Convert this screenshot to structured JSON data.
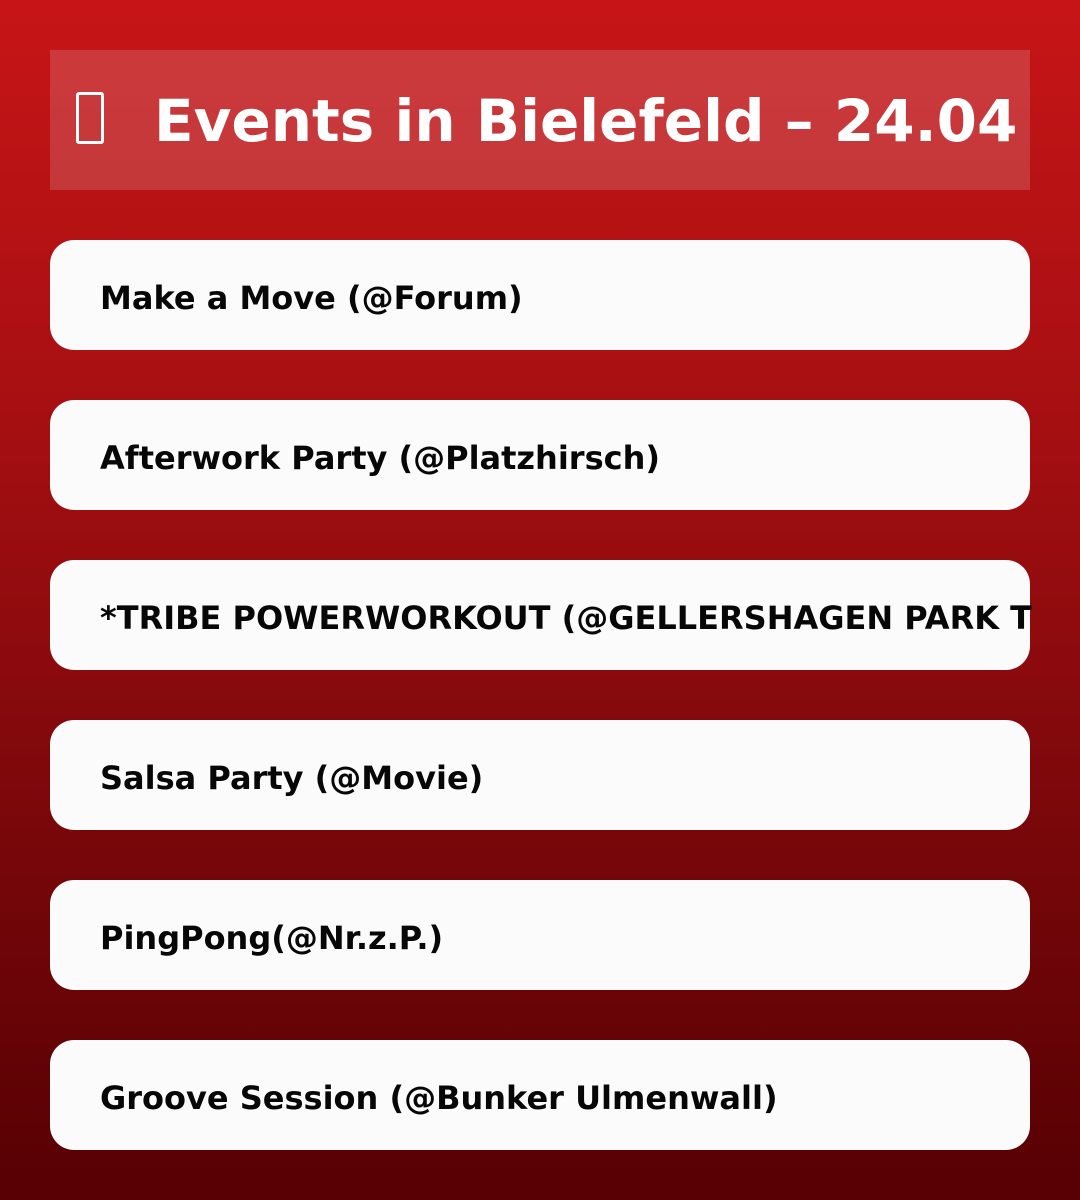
{
  "header": {
    "icon": "calendar-icon",
    "title": "Events in Bielefeld – 24.04"
  },
  "events": [
    {
      "label": "Make a Move (@Forum)"
    },
    {
      "label": "Afterwork Party (@Platzhirsch)"
    },
    {
      "label": "*TRIBE POWERWORKOUT (@GELLERSHAGEN PARK T"
    },
    {
      "label": "Salsa Party (@Movie)"
    },
    {
      "label": "PingPong(@Nr.z.P.)"
    },
    {
      "label": "Groove Session (@Bunker Ulmenwall)"
    }
  ],
  "colors": {
    "background_top": "#c71517",
    "background_bottom": "#560003",
    "card": "#fbfbfb",
    "text": "#070707",
    "header_text": "#ffffff"
  }
}
